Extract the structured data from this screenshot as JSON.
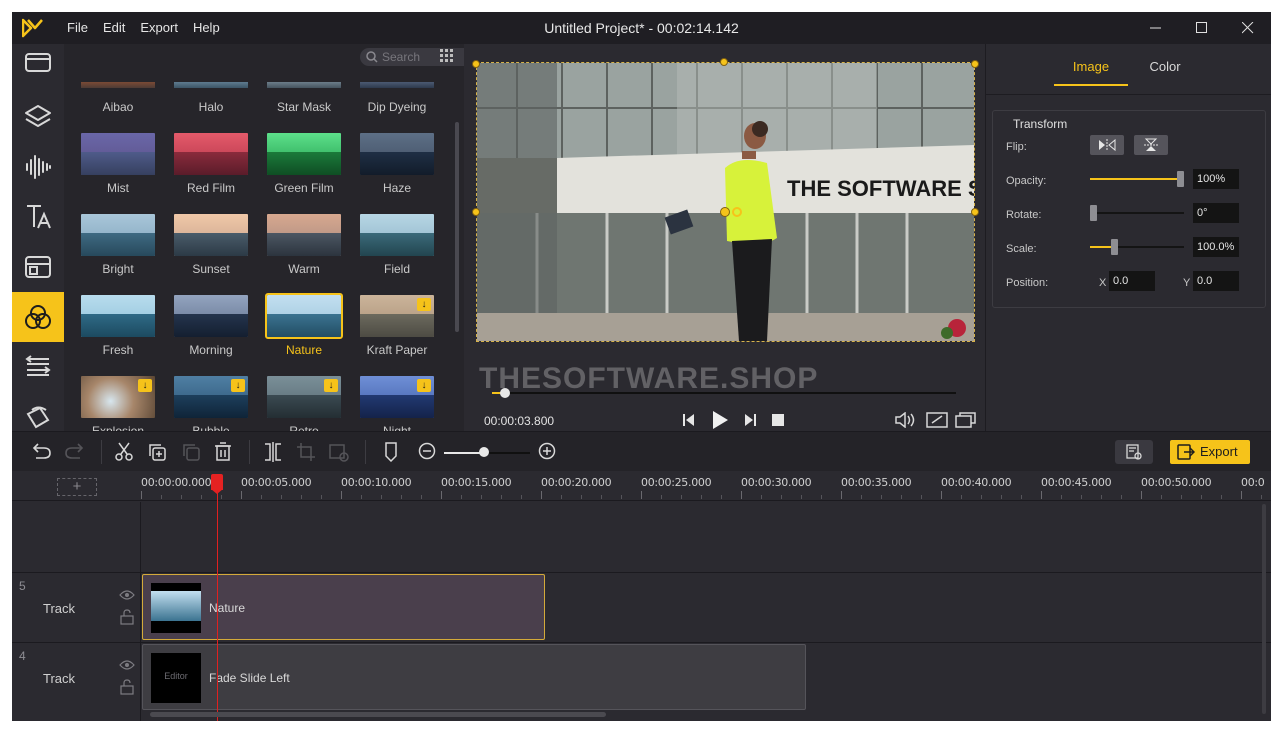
{
  "app": {
    "title": "Untitled Project* - 00:02:14.142",
    "menu": [
      "File",
      "Edit",
      "Export",
      "Help"
    ]
  },
  "library": {
    "search_placeholder": "Search",
    "top_row": [
      "Aibao",
      "Halo",
      "Star Mask",
      "Dip Dyeing"
    ],
    "filters": [
      {
        "label": "Mist",
        "download": false
      },
      {
        "label": "Red Film",
        "download": false
      },
      {
        "label": "Green Film",
        "download": false
      },
      {
        "label": "Haze",
        "download": false
      },
      {
        "label": "Bright",
        "download": false
      },
      {
        "label": "Sunset",
        "download": false
      },
      {
        "label": "Warm",
        "download": false
      },
      {
        "label": "Field",
        "download": false
      },
      {
        "label": "Fresh",
        "download": false
      },
      {
        "label": "Morning",
        "download": false
      },
      {
        "label": "Nature",
        "download": false,
        "selected": true
      },
      {
        "label": "Kraft Paper",
        "download": true
      },
      {
        "label": "Explosion",
        "download": true
      },
      {
        "label": "Bubble",
        "download": true
      },
      {
        "label": "Retro",
        "download": true
      },
      {
        "label": "Night",
        "download": true
      }
    ]
  },
  "preview": {
    "sign_text": "THE SOFTWARE SHOP",
    "watermark": "THESOFTWARE.SHOP",
    "current_time": "00:00:03.800",
    "progress_fraction": 0.028
  },
  "properties": {
    "tabs": [
      "Image",
      "Color"
    ],
    "active_tab": "Image",
    "section_title": "Transform",
    "flip_label": "Flip:",
    "opacity_label": "Opacity:",
    "opacity_value": "100%",
    "opacity_fraction": 1.0,
    "rotate_label": "Rotate:",
    "rotate_value": "0°",
    "rotate_fraction": 0.0,
    "scale_label": "Scale:",
    "scale_value": "100.0%",
    "scale_fraction": 0.25,
    "position_label": "Position:",
    "x_label": "X",
    "x_value": "0.0",
    "y_label": "Y",
    "y_value": "0.0"
  },
  "toolbar": {
    "export_label": "Export",
    "zoom_fraction": 0.47
  },
  "timeline": {
    "ticks": [
      "00:00:00.000",
      "00:00:05.000",
      "00:00:10.000",
      "00:00:15.000",
      "00:00:20.000",
      "00:00:25.000",
      "00:00:30.000",
      "00:00:35.000",
      "00:00:40.000",
      "00:00:45.000",
      "00:00:50.000",
      "00:0"
    ],
    "tracks": [
      {
        "number": "5",
        "name": "Track",
        "clip_label": "Nature"
      },
      {
        "number": "4",
        "name": "Track",
        "clip_label": "Fade Slide Left",
        "clip_thumb_text": "Editor"
      }
    ]
  },
  "colors": {
    "accent": "#f6c31a",
    "panel": "#2b2a30",
    "titlebar": "#1f1e23",
    "playhead": "#e52222"
  }
}
